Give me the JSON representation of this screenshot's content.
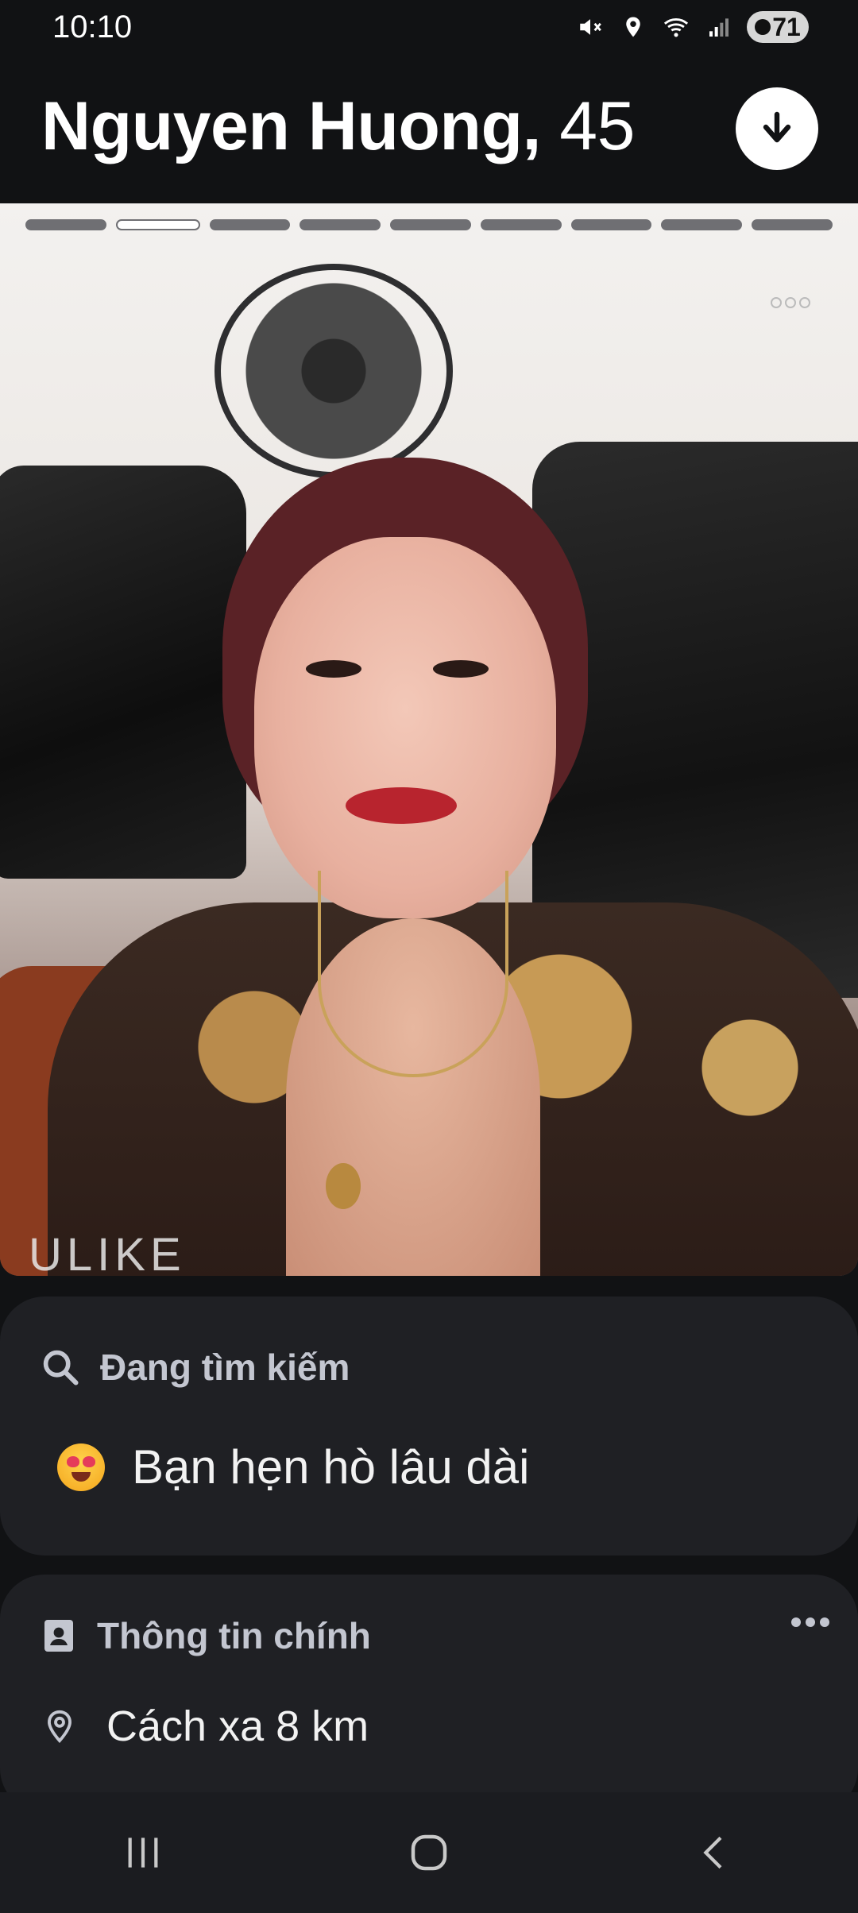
{
  "status_bar": {
    "time": "10:10",
    "battery": "71",
    "icons": [
      "mute-icon",
      "location-icon",
      "wifi-icon",
      "signal-icon"
    ]
  },
  "header": {
    "name": "Nguyen Huong,",
    "age": "45",
    "collapse_icon": "arrow-down-icon"
  },
  "photo": {
    "segments_total": 9,
    "active_segment": 2,
    "watermark": "ULIKE"
  },
  "looking_for": {
    "label": "Đang tìm kiếm",
    "value": "Bạn hẹn hò lâu dài",
    "emoji": "heart-eyes-emoji"
  },
  "basics": {
    "label": "Thông tin chính",
    "distance": "Cách xa 8 km"
  },
  "colors": {
    "background": "#111214",
    "card": "#1f2024",
    "label": "#c3c6d0",
    "accent_white": "#ffffff"
  }
}
